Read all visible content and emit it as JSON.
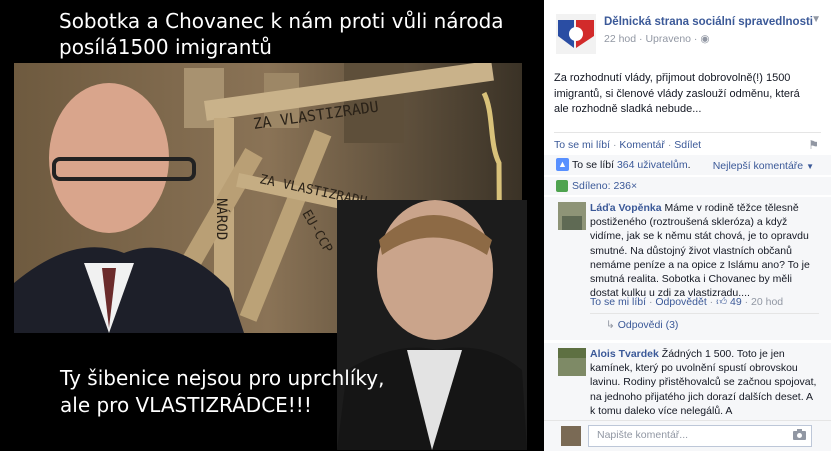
{
  "meme": {
    "top_line1": "Sobotka a Chovanec k nám proti vůli národa",
    "top_line2": "posílá1500 imigrantů",
    "bottom_line1": "Ty šibenice nejsou pro uprchlíky,",
    "bottom_line2": "ale pro VLASTIZRÁDCE!!!",
    "gallows_word1": "ZA VLASTIZRADU",
    "gallows_word2": "NÁROD",
    "gallows_word3": "ZA VLASTIZRADU",
    "gallows_word4": "EU-CCP"
  },
  "post": {
    "page_name": "Dělnická strana sociální spravedlnosti",
    "time": "22 hod",
    "edited": "Upraveno",
    "text": "Za rozhodnutí vlády, přijmout dobrovolně(!) 1500 imigrantů, si členové vlády zaslouží odměnu, která ale rozhodně sladká nebude...",
    "action_like": "To se mi líbí",
    "action_comment": "Komentář",
    "action_share": "Sdílet",
    "likes_prefix": "To se líbí ",
    "likes_count": "364 uživatelům",
    "likes_suffix": ".",
    "sort_label": "Nejlepší komentáře",
    "shares": "Sdíleno: 236×"
  },
  "comments": [
    {
      "author": "Láďa Vopěnka",
      "text": "Máme v rodině těžce tělesně postiženého (roztroušená skleróza) a když vidíme, jak se k němu stát chová, je to opravdu smutné. Na důstojný život vlastních občanů nemáme peníze a na opice z Islámu ano? To je smutná realita. Sobotka i Chovanec by měli dostat kulku u zdi za vlastizradu....",
      "like": "To se mi líbí",
      "reply": "Odpovědět",
      "likes": "49",
      "time": "20 hod",
      "replies": "Odpovědi (3)"
    },
    {
      "author": "Alois Tvardek",
      "text": "Žádných 1 500. Toto je jen kamínek, který po uvolnění spustí obrovskou lavinu. Rodiny přistěhovalců se začnou spojovat, na jednoho přijatého jich dorazí dalších deset. A k tomu daleko více nelegálů. A"
    }
  ],
  "compose": {
    "placeholder": "Napište komentář..."
  },
  "icons": {
    "chevron": "chevron-down-icon",
    "flag": "flag-icon",
    "like": "thumbs-up-icon",
    "share": "share-icon",
    "camera": "camera-icon",
    "globe": "globe-icon"
  },
  "colors": {
    "link": "#3b5998",
    "meta": "#9197a3",
    "like_blue": "#5890ff"
  }
}
